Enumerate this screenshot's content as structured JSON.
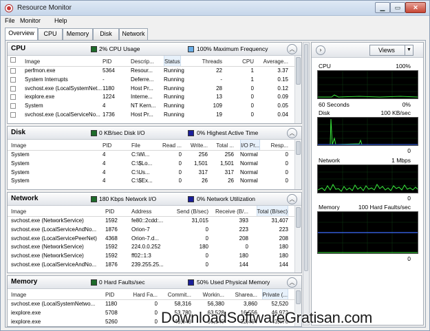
{
  "window": {
    "title": "Resource Monitor",
    "min": "▁",
    "max": "▭",
    "close": "✕"
  },
  "menu": {
    "file": "File",
    "monitor": "Monitor",
    "help": "Help"
  },
  "tabs": [
    "Overview",
    "CPU",
    "Memory",
    "Disk",
    "Network"
  ],
  "cpu": {
    "title": "CPU",
    "stat1": "2% CPU Usage",
    "stat2": "100% Maximum Frequency",
    "c1": "#1e6b2a",
    "c2": "#6aaee8",
    "columns": [
      "Image",
      "PID",
      "Descrip...",
      "Status",
      "Threads",
      "CPU",
      "Average..."
    ],
    "rows": [
      [
        "perfmon.exe",
        "5364",
        "Resour...",
        "Running",
        "22",
        "1",
        "3.37"
      ],
      [
        "System Interrupts",
        "-",
        "Deferre...",
        "Running",
        "-",
        "1",
        "0.15"
      ],
      [
        "svchost.exe (LocalSystemNet...",
        "1180",
        "Host Pr...",
        "Running",
        "28",
        "0",
        "0.12"
      ],
      [
        "iexplore.exe",
        "1224",
        "Interne...",
        "Running",
        "13",
        "0",
        "0.09"
      ],
      [
        "System",
        "4",
        "NT Kern...",
        "Running",
        "109",
        "0",
        "0.05"
      ],
      [
        "svchost.exe (LocalServiceNo...",
        "1736",
        "Host Pr...",
        "Running",
        "19",
        "0",
        "0.04"
      ]
    ]
  },
  "disk": {
    "title": "Disk",
    "stat1": "0 KB/sec Disk I/O",
    "stat2": "0% Highest Active Time",
    "c1": "#1e6b2a",
    "c2": "#1a1f9a",
    "columns": [
      "Image",
      "PID",
      "File",
      "Read ...",
      "Write...",
      "Total ...",
      "I/O Pr...",
      "Resp..."
    ],
    "rows": [
      [
        "System",
        "4",
        "C:\\Wi...",
        "0",
        "256",
        "256",
        "Normal",
        "0"
      ],
      [
        "System",
        "4",
        "C:\\$Lo...",
        "0",
        "1,501",
        "1,501",
        "Normal",
        "0"
      ],
      [
        "System",
        "4",
        "C:\\Us...",
        "0",
        "317",
        "317",
        "Normal",
        "0"
      ],
      [
        "System",
        "4",
        "C:\\$Ex...",
        "0",
        "26",
        "26",
        "Normal",
        "0"
      ]
    ]
  },
  "network": {
    "title": "Network",
    "stat1": "180 Kbps Network I/O",
    "stat2": "0% Network Utilization",
    "c1": "#1e6b2a",
    "c2": "#1a1f9a",
    "columns": [
      "Image",
      "PID",
      "Address",
      "Send (B/sec)",
      "Receive (B/...",
      "Total (B/sec)"
    ],
    "rows": [
      [
        "svchost.exe (NetworkService)",
        "1592",
        "fe80::2cdd:...",
        "31,015",
        "393",
        "31,407"
      ],
      [
        "svchost.exe (LocalServiceAndNo...",
        "1876",
        "Orion-7",
        "0",
        "223",
        "223"
      ],
      [
        "svchost.exe (LocalServicePeerNet)",
        "4368",
        "Orion-7.d...",
        "0",
        "208",
        "208"
      ],
      [
        "svchost.exe (NetworkService)",
        "1592",
        "224.0.0.252",
        "180",
        "0",
        "180"
      ],
      [
        "svchost.exe (NetworkService)",
        "1592",
        "ff02::1:3",
        "0",
        "180",
        "180"
      ],
      [
        "svchost.exe (LocalServiceAndNo...",
        "1876",
        "239.255.25...",
        "0",
        "144",
        "144"
      ]
    ]
  },
  "memory": {
    "title": "Memory",
    "stat1": "0 Hard Faults/sec",
    "stat2": "50% Used Physical Memory",
    "c1": "#1e6b2a",
    "c2": "#1a1f9a",
    "columns": [
      "Image",
      "PID",
      "Hard Fa...",
      "Commit...",
      "Workin...",
      "Sharea...",
      "Private (..."
    ],
    "rows": [
      [
        "svchost.exe (LocalSystemNetwo...",
        "1180",
        "0",
        "58,316",
        "56,380",
        "3,860",
        "52,520"
      ],
      [
        "iexplore.exe",
        "5708",
        "0",
        "53,780",
        "63,528",
        "16,556",
        "46,972"
      ],
      [
        "iexplore.exe",
        "5260",
        "0",
        "49,948",
        "66,140",
        "22,464",
        "43,676"
      ]
    ]
  },
  "right": {
    "views": "Views",
    "cpu": {
      "label": "CPU",
      "max": "100%",
      "foot_left": "60 Seconds",
      "foot_right": "0%"
    },
    "disk": {
      "label": "Disk",
      "max": "100 KB/sec",
      "min": "0"
    },
    "network": {
      "label": "Network",
      "max": "1 Mbps",
      "min": "0"
    },
    "memory": {
      "label": "Memory",
      "max": "100 Hard Faults/sec",
      "min": "0"
    }
  },
  "watermark": "DownloadSoftwareGratisan.com"
}
